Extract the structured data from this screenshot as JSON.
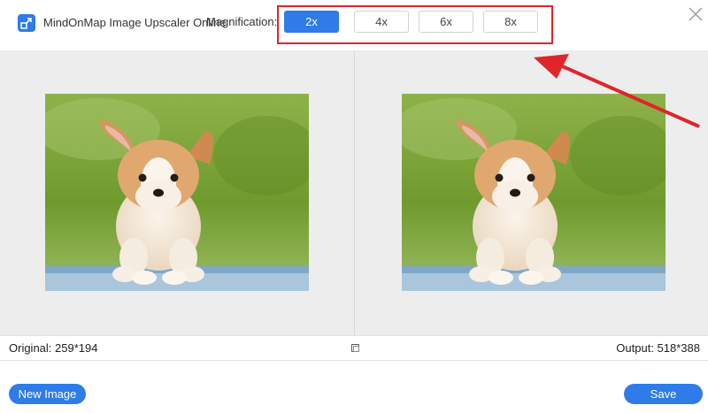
{
  "header": {
    "app_title": "MindOnMap Image Upscaler Online",
    "magnification_label": "Magnification:",
    "magnification_options": [
      "2x",
      "4x",
      "6x",
      "8x"
    ],
    "selected_magnification": "2x"
  },
  "icons": {
    "app": "upscale-arrow-icon",
    "close": "close-icon",
    "compare": "compare-icon"
  },
  "preview": {
    "original_size_text": "Original: 259*194",
    "output_size_text": "Output: 518*388"
  },
  "footer": {
    "new_image_label": "New Image",
    "save_label": "Save"
  },
  "colors": {
    "accent": "#2f7be8",
    "annotation": "#e0252a",
    "panel_background": "#ededed"
  }
}
